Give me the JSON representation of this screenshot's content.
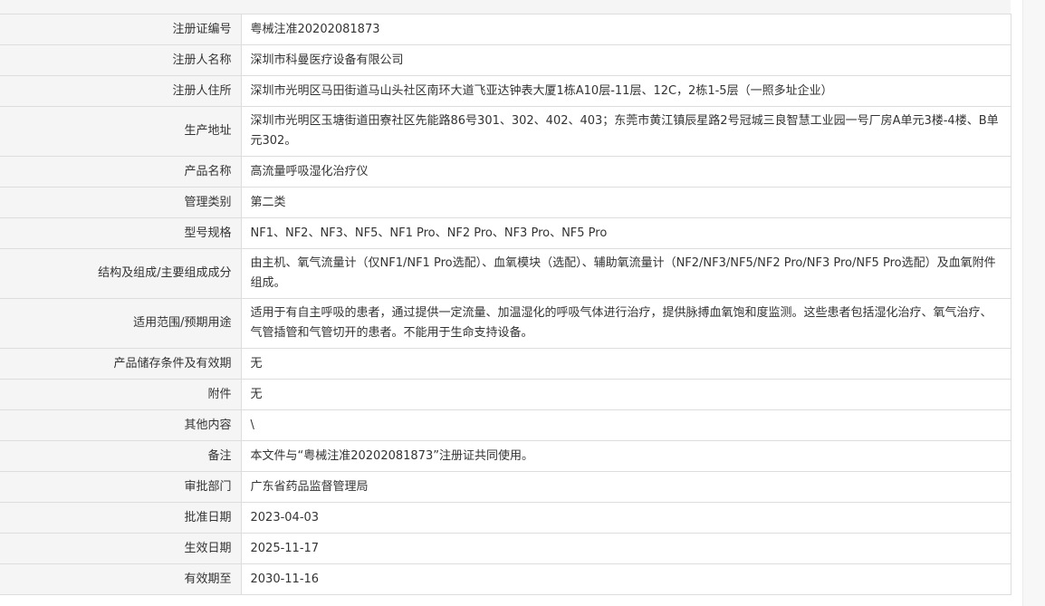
{
  "rows": [
    {
      "key": "reg_no",
      "label": "注册证编号",
      "value": "粤械注准20202081873"
    },
    {
      "key": "registrant_name",
      "label": "注册人名称",
      "value": "深圳市科曼医疗设备有限公司"
    },
    {
      "key": "registrant_address",
      "label": "注册人住所",
      "value": "深圳市光明区马田街道马山头社区南环大道飞亚达钟表大厦1栋A10层-11层、12C，2栋1-5层（一照多址企业）"
    },
    {
      "key": "production_address",
      "label": "生产地址",
      "value": "深圳市光明区玉塘街道田寮社区先能路86号301、302、402、403；东莞市黄江镇辰星路2号冠城三良智慧工业园一号厂房A单元3楼-4楼、B单元302。"
    },
    {
      "key": "product_name",
      "label": "产品名称",
      "value": "高流量呼吸湿化治疗仪"
    },
    {
      "key": "management_class",
      "label": "管理类别",
      "value": "第二类"
    },
    {
      "key": "model_spec",
      "label": "型号规格",
      "value": "NF1、NF2、NF3、NF5、NF1 Pro、NF2 Pro、NF3 Pro、NF5 Pro"
    },
    {
      "key": "structure",
      "label": "结构及组成/主要组成成分",
      "value": "由主机、氧气流量计（仅NF1/NF1 Pro选配）、血氧模块（选配）、辅助氧流量计（NF2/NF3/NF5/NF2 Pro/NF3 Pro/NF5 Pro选配）及血氧附件组成。"
    },
    {
      "key": "intended_use",
      "label": "适用范围/预期用途",
      "value": "适用于有自主呼吸的患者，通过提供一定流量、加温湿化的呼吸气体进行治疗，提供脉搏血氧饱和度监测。这些患者包括湿化治疗、氧气治疗、气管插管和气管切开的患者。不能用于生命支持设备。"
    },
    {
      "key": "storage",
      "label": "产品储存条件及有效期",
      "value": "无"
    },
    {
      "key": "attachment",
      "label": "附件",
      "value": "无"
    },
    {
      "key": "other",
      "label": "其他内容",
      "value": "\\"
    },
    {
      "key": "remark",
      "label": "备注",
      "value": "本文件与“粤械注准20202081873”注册证共同使用。"
    },
    {
      "key": "approval_dept",
      "label": "审批部门",
      "value": "广东省药品监督管理局"
    },
    {
      "key": "approval_date",
      "label": "批准日期",
      "value": "2023-04-03"
    },
    {
      "key": "effective_date",
      "label": "生效日期",
      "value": "2025-11-17"
    },
    {
      "key": "expiry_date",
      "label": "有效期至",
      "value": "2030-11-16"
    }
  ]
}
